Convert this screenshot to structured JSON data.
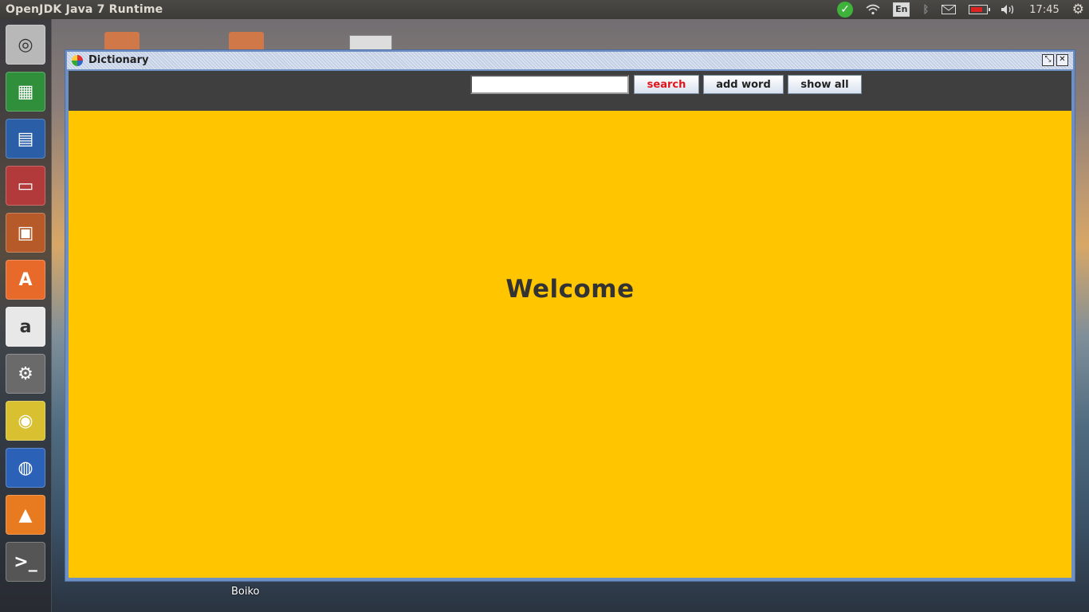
{
  "top_panel": {
    "app_title": "OpenJDK Java 7 Runtime",
    "keyboard_layout": "En",
    "time": "17:45",
    "tray_icons": [
      "update-check-icon",
      "wifi-icon",
      "keyboard-layout-indicator",
      "bluetooth-icon",
      "mail-icon",
      "battery-icon",
      "volume-icon",
      "session-gear-icon"
    ]
  },
  "launcher": {
    "items": [
      {
        "name": "ubuntu-dash-icon",
        "glyph": "◎",
        "color": "#b8b8b8"
      },
      {
        "name": "libreoffice-calc-icon",
        "glyph": "▦",
        "color": "#2f8f3a"
      },
      {
        "name": "libreoffice-writer-icon",
        "glyph": "▤",
        "color": "#2a5fa8"
      },
      {
        "name": "file-manager-icon",
        "glyph": "▭",
        "color": "#b23a3a"
      },
      {
        "name": "libreoffice-impress-icon",
        "glyph": "▣",
        "color": "#b65a2a"
      },
      {
        "name": "software-center-icon",
        "glyph": "A",
        "color": "#e86a2a"
      },
      {
        "name": "amazon-icon",
        "glyph": "a",
        "color": "#e8e8e8"
      },
      {
        "name": "system-settings-icon",
        "glyph": "⚙",
        "color": "#6a6a6a"
      },
      {
        "name": "chrome-icon",
        "glyph": "◉",
        "color": "#d8c030"
      },
      {
        "name": "google-earth-icon",
        "glyph": "◍",
        "color": "#2b62b8"
      },
      {
        "name": "vlc-icon",
        "glyph": "▲",
        "color": "#e87a20"
      },
      {
        "name": "terminal-icon",
        "glyph": ">_",
        "color": "#555555"
      }
    ]
  },
  "desktop": {
    "label": "Boiko"
  },
  "window": {
    "title": "Dictionary",
    "search_value": "",
    "buttons": {
      "search": "search",
      "add_word": "add word",
      "show_all": "show all"
    },
    "welcome_text": "Welcome",
    "colors": {
      "toolbar_bg": "#3f3f3f",
      "main_bg": "#ffc600",
      "search_label": "#e0151b"
    }
  }
}
